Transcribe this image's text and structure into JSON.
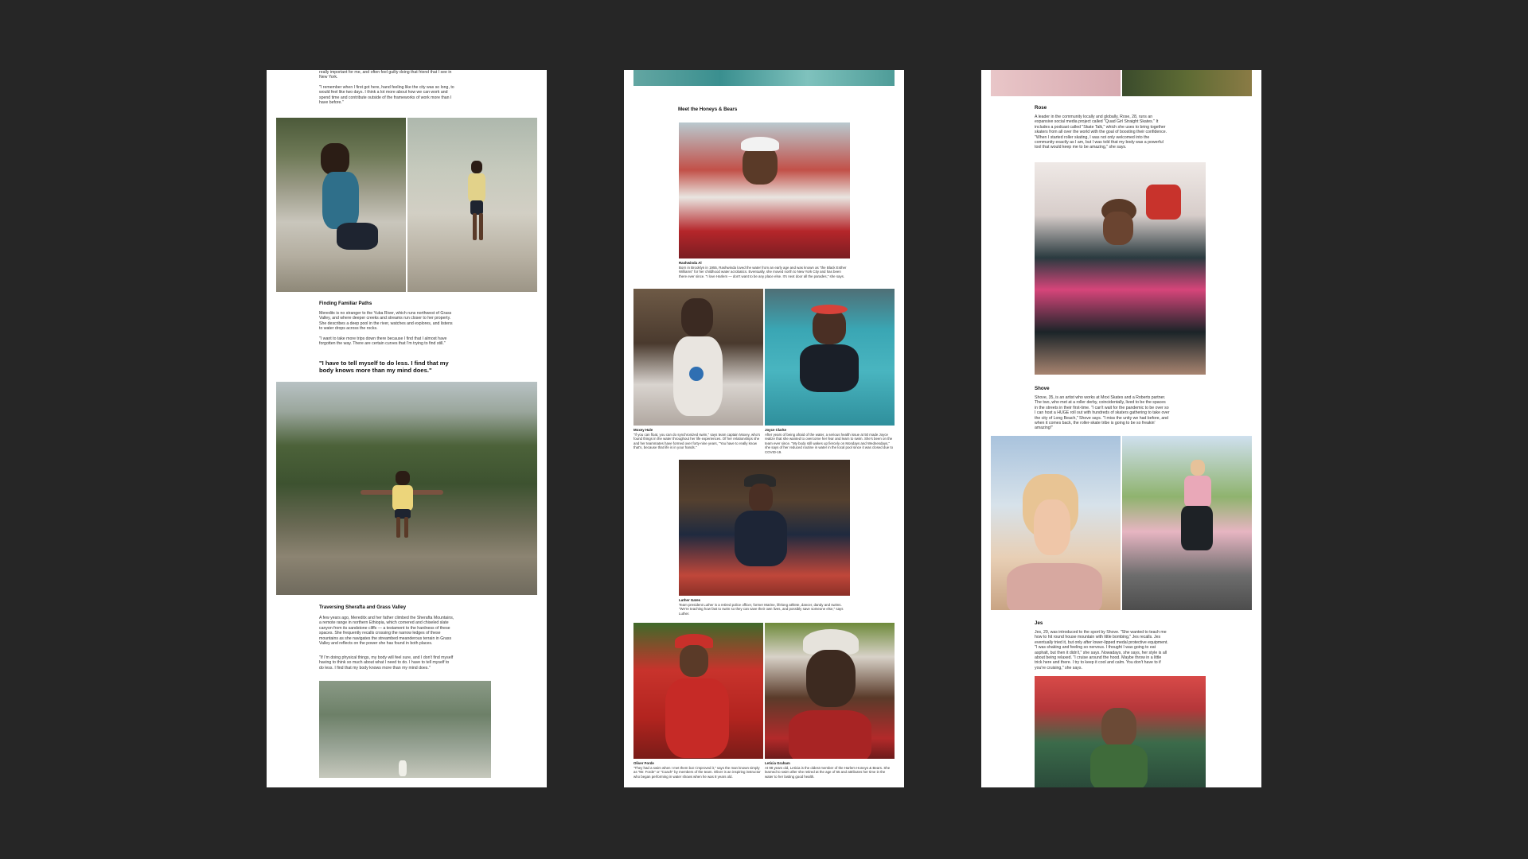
{
  "page1": {
    "intro_p1": "really important for me, and often feel guilty doing that friend that I see in New York.",
    "intro_p2": "\"I remember when I first got here, hand feeling like the city was so long, to would feel like two days. I think a lot more about how we can work and spend time and contribute outside of the frameworks of work more than I have before.\"",
    "section1_title": "Finding Familiar Paths",
    "section1_p1": "Mereditx is no stranger to the Yuba River, which runs northwest of Grass Valley, and where deeper creeks and streams run closer to her property. She describes a deep pool in the river, watches and explores, and listens to water drops across the rocks.",
    "section1_p2": "\"I want to take more trips down there because I find that I almost have forgotten the way. There are certain curves that I'm trying to find still.\"",
    "pull_quote": "\"I have to tell myself to do less. I find that my body knows more than my mind does.\"",
    "section2_title": "Traversing Sherafta and Grass Valley",
    "section2_p1": "A few years ago, Mereditx and her father climbed the Sherafta Mountains, a remote range in northern Ethiopia, which cornered and chiseled slate canyon from its sandstone cliffs — a testament to the hardness of these spaces. She frequently recalls crossing the narrow ledges of these mountains as she navigates the streambed meanderous terrain in Grass Valley and reflects on the power she has found in both places.",
    "section2_p2": "\"If I'm doing physical things, my body will feel sure, and I don't find myself having to think so much about what I need to do. I have to tell myself to do less. I find that my body knows more than my mind does.\""
  },
  "page2": {
    "section_title": "Meet the Honeys & Bears",
    "cap1_name": "Rashwinda Al",
    "cap1_text": "Born in Brooklyn in 1955, Rashwinda loved the water from an early age and was known as \"the Black Esther Williams\" for her childhood water acrobatics. Eventually, she moved north to New York City and has been there ever since. \"I love Harlem — don't want to be any place else. It's next door all the parades,\" she says.",
    "cap2_name": "Moxey Hale",
    "cap2_text": "\"If you can float, you can do synchronized swim,\" says team captain Moxey, who's found things in the water throughout her life experiences. Of her relationships she and her teammates have formed over forty-nine years, \"You have to really know that's, because that life is in your hands.\"",
    "cap3_name": "Joyce Clarke",
    "cap3_text": "After years of being afraid of the water, a serious health issue at 50 made Joyce realize that she wanted to overcome her fear and learn to swim. She's been on the team ever since. \"My body still wakes up fiercely on Mondays and Wednesdays,\" she says of her reduced routine in water in the local pool since it was closed due to COVID-19.",
    "cap4_name": "Luther Gates",
    "cap4_text": "Team president Luther is a retired police officer, former Marine, lifelong athlete, dancer, dandy and swims. \"We're teaching how fast to swim so they can save their own lives, and possibly save someone else,\" says Luther.",
    "cap5_name": "Oliver Forde",
    "cap5_text": "\"They had a swim when I met them but I improved it,\" says the man known simply as \"Mr. Forde\" or \"Coach\" by members of the team. Oliver is an inspiring instructor who began performing in water shows when he was 8 years old.",
    "cap6_name": "Leticia Graham",
    "cap6_text": "At 98 years old, Leticia is the oldest member of the Harlem Honeys & Bears. She learned to swim after she retired at the age of 65 and attributes her time in the water to her lasting good health."
  },
  "page3": {
    "section1_title": "Rose",
    "section1_text": "A leader in the community locally and globally, Rose, 28, runs an expansive social media project called \"Quad Girl Straight Skates.\" It includes a podcast called \"Skate Talk,\" which she uses to bring together skaters from all over the world with the goal of boosting their confidence. \"When I started roller skating, I was not only welcomed into the community exactly as I am, but I was told that my body was a powerful tool that would keep me to be amazing,\" she says.",
    "section2_title": "Shove",
    "section2_text": "Shove, 35, is an artist who works at Moxi Skates and a Roberts partner. The two, who met at a roller derby, coincidentally, lived to be the spaces in the streets in their first-time. \"I can't wait for the pandemic to be over so I can host a HUGE roll out with hundreds of skaters gathering to take over the city of Long Beach,\" Shove says. \"I miss the unity we had before, and when it comes back, the roller-skate tribe is going to be so freakin' amazing!\"",
    "section3_title": "Jes",
    "section3_text": "Jes, 29, was introduced to the sport by Shove. \"She wanted to teach me how to hit round house mountain with little bombing,\" Jes recalls. Jes eventually tried it, but only after lower-lipped medal protective equipment. \"I was shaking and feeling so nervous. I thought I was going to eat asphalt, but then it didn't,\" she says. Nowadays, she says, her style is all about being relaxed. \"I cruise around the hood. Maybe throw in a little trick here and there. I try to keep it cool and calm. You don't have to if you're cruising,\" she says."
  }
}
